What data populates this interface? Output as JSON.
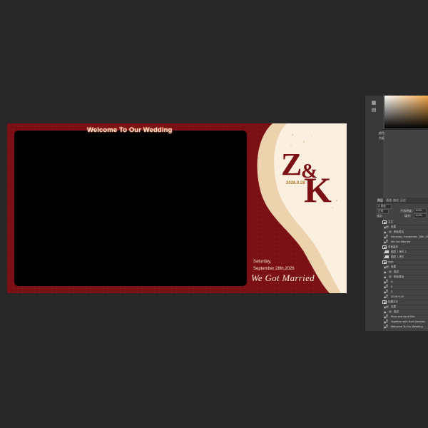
{
  "canvas": {
    "welcome_text": "Welcome To Our Wedding",
    "monogram": {
      "first": "Z",
      "amp": "&",
      "second": "K",
      "date": "2026.9.28"
    },
    "date_line1": "Saturday,",
    "date_line2": "September 28th,2026",
    "married_text": "We Got Married",
    "colors": {
      "background": "#7a0f14",
      "cream": "#fbf0df",
      "beige": "#ecd2ad",
      "gold": "#b07a2e"
    }
  },
  "panel": {
    "label_1": "颜色",
    "label_2": "色板",
    "tabs": [
      "图层",
      "通道",
      "路径",
      "历史"
    ],
    "kind_filter": "Q 类型",
    "blend_mode": "正常",
    "opacity_label": "不透明度:",
    "opacity": "100%",
    "lock_label": "锁定:",
    "fill_label": "填充:",
    "fill": "100%",
    "layers": [
      {
        "type": "folder",
        "name": "文字",
        "indent": 0
      },
      {
        "type": "fx",
        "name": "效果",
        "indent": 1
      },
      {
        "type": "fx",
        "name": "颜色叠加",
        "indent": 2
      },
      {
        "type": "text",
        "name": "Saturday, September 28th, 2026",
        "indent": 1
      },
      {
        "type": "text",
        "name": "We Got Married",
        "indent": 1
      },
      {
        "type": "folder",
        "name": "背景装饰",
        "indent": 0
      },
      {
        "type": "image",
        "name": "图层 1 拷贝 2",
        "indent": 1
      },
      {
        "type": "image",
        "name": "图层 1 拷贝",
        "indent": 1
      },
      {
        "type": "folder",
        "name": "logo",
        "indent": 0
      },
      {
        "type": "fx",
        "name": "效果",
        "indent": 1
      },
      {
        "type": "fx",
        "name": "描边",
        "indent": 2
      },
      {
        "type": "fx",
        "name": "颜色叠加",
        "indent": 2
      },
      {
        "type": "text",
        "name": "&",
        "indent": 1
      },
      {
        "type": "text",
        "name": "K",
        "indent": 1
      },
      {
        "type": "text",
        "name": "Z",
        "indent": 1
      },
      {
        "type": "text",
        "name": "2026.9.28",
        "indent": 1
      },
      {
        "type": "folder",
        "name": "标题文字",
        "indent": 0
      },
      {
        "type": "fx",
        "name": "效果",
        "indent": 1
      },
      {
        "type": "fx",
        "name": "描边",
        "indent": 2
      },
      {
        "type": "text",
        "name": "Price and Kent Ellis",
        "indent": 1
      },
      {
        "type": "text",
        "name": "Together with their families",
        "indent": 1
      },
      {
        "type": "text",
        "name": "Welcome To Our Wedding",
        "indent": 1
      }
    ]
  }
}
